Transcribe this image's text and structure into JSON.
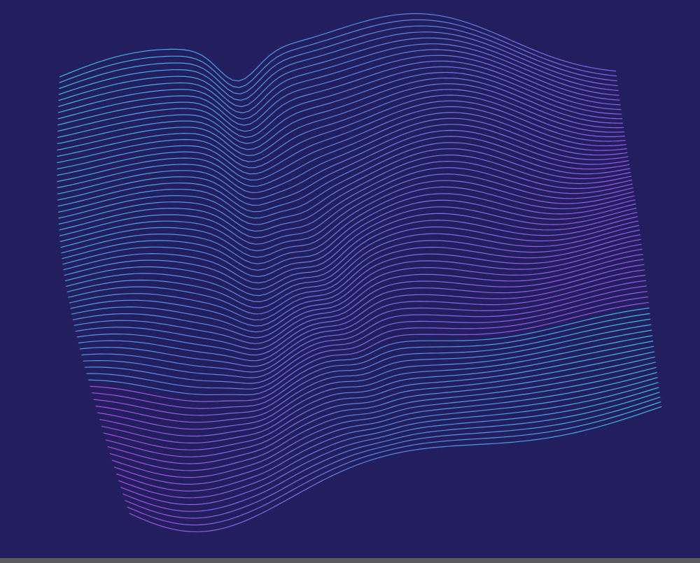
{
  "artwork": {
    "subject": "flowing-wave-lines",
    "background_color": "#231f5e",
    "gradient_colors": {
      "cyan": "#3cc3f5",
      "blue": "#5a8cf2",
      "purple": "#a15af5",
      "magenta": "#bd46ef"
    },
    "line_count": 72
  },
  "bottom_bar": {
    "color": "#5b5b5f"
  }
}
